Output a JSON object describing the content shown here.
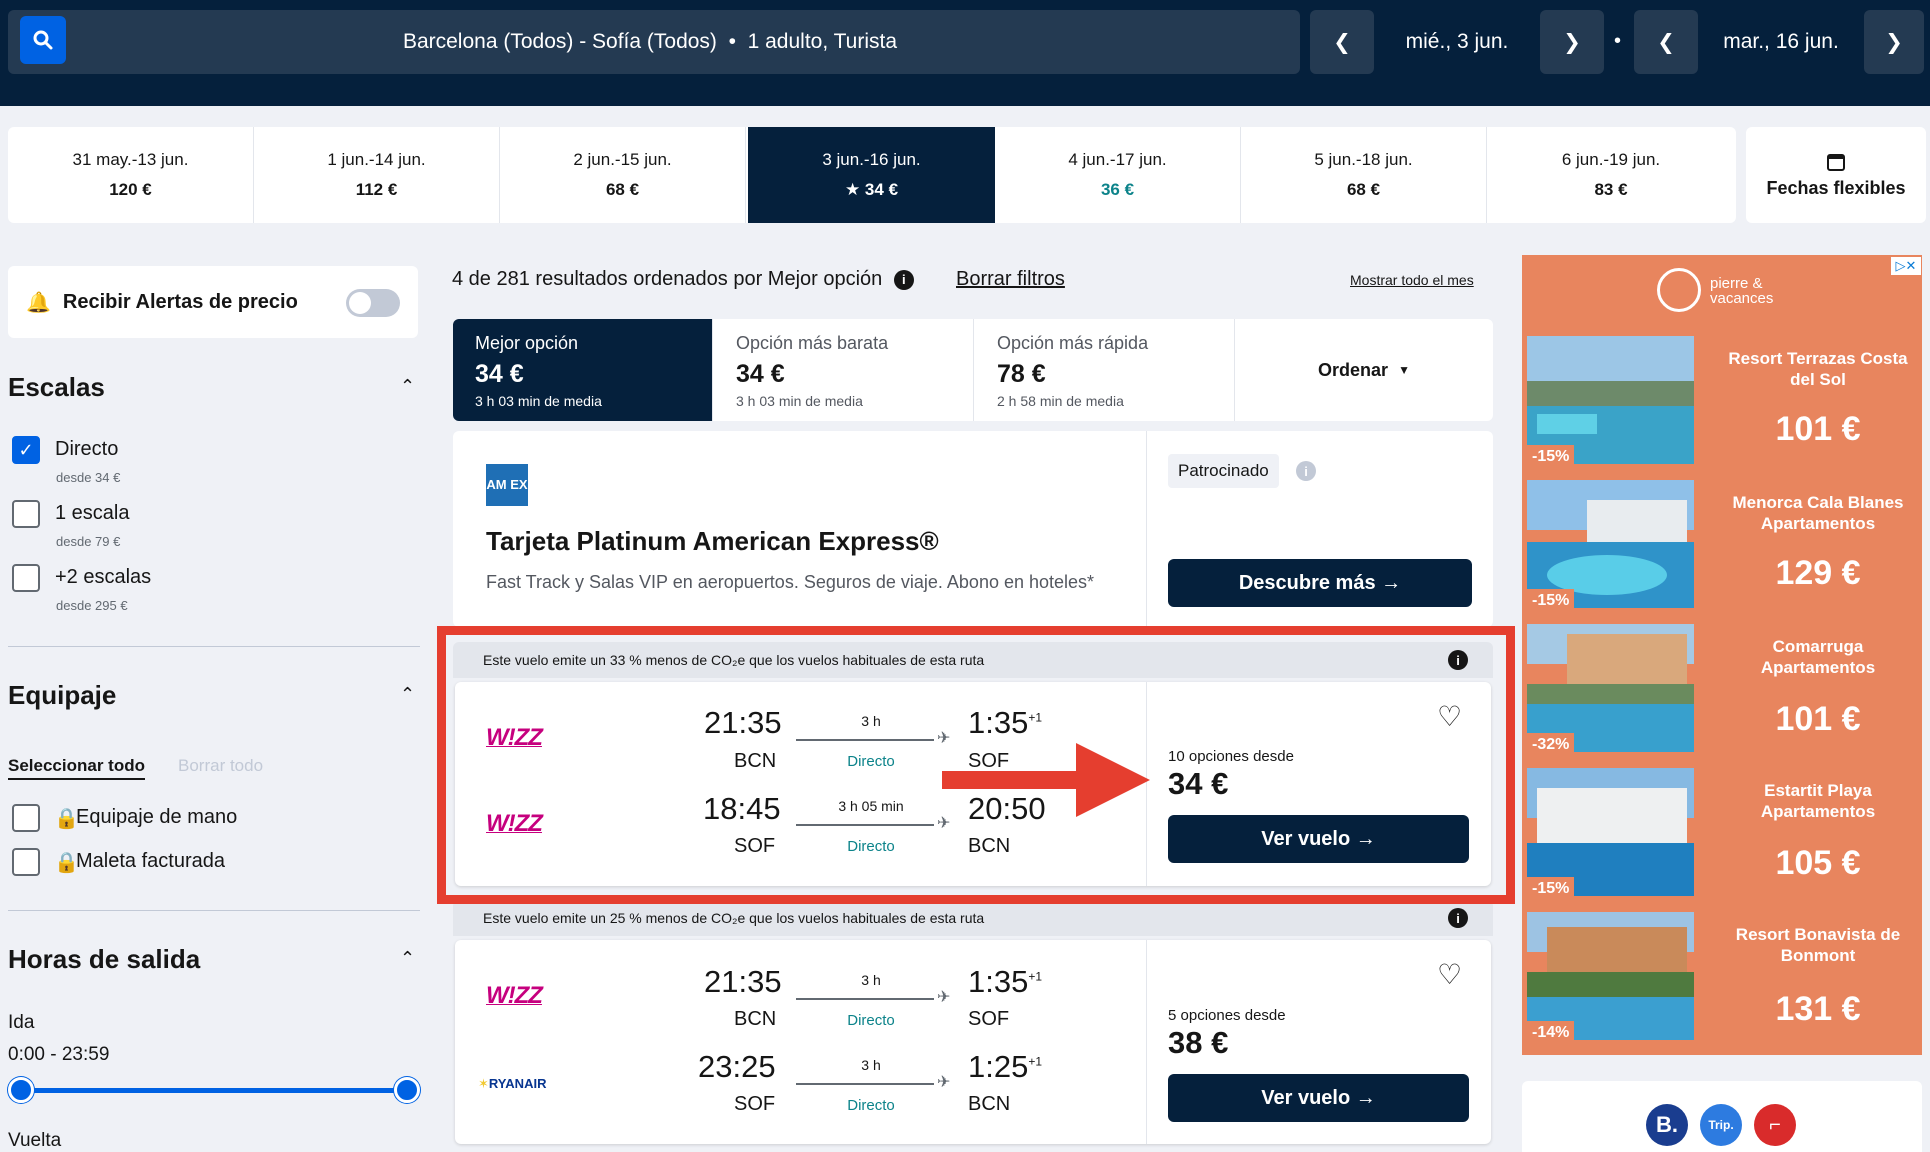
{
  "search": {
    "route": "Barcelona (Todos) - Sofía (Todos)  •  1 adulto, Turista",
    "depart_date": "mié., 3 jun.",
    "return_date": "mar., 16 jun."
  },
  "date_strip": [
    {
      "dates": "31 may.-13 jun.",
      "price": "120 €"
    },
    {
      "dates": "1 jun.-14 jun.",
      "price": "112 €"
    },
    {
      "dates": "2 jun.-15 jun.",
      "price": "68 €"
    },
    {
      "dates": "3 jun.-16 jun.",
      "price": "★ 34 €"
    },
    {
      "dates": "4 jun.-17 jun.",
      "price": "36 €"
    },
    {
      "dates": "5 jun.-18 jun.",
      "price": "68 €"
    },
    {
      "dates": "6 jun.-19 jun.",
      "price": "83 €"
    }
  ],
  "flexible_dates": "Fechas flexibles",
  "sidebar": {
    "alerts_label": "Recibir Alertas de precio",
    "stops_title": "Escalas",
    "stops": [
      {
        "label": "Directo",
        "sub": "desde 34 €",
        "checked": true
      },
      {
        "label": "1 escala",
        "sub": "desde 79 €",
        "checked": false
      },
      {
        "label": "+2 escalas",
        "sub": "desde 295 €",
        "checked": false
      }
    ],
    "baggage_title": "Equipaje",
    "select_all": "Seleccionar todo",
    "clear_all": "Borrar todo",
    "baggage": [
      "Equipaje de mano",
      "Maleta facturada"
    ],
    "times_title": "Horas de salida",
    "outbound_label": "Ida",
    "outbound_range": "0:00 - 23:59",
    "return_label": "Vuelta"
  },
  "results": {
    "summary": "4 de 281 resultados ordenados por Mejor opción",
    "clear_filters": "Borrar filtros",
    "whole_month": "Mostrar todo el mes"
  },
  "sort_tabs": [
    {
      "title": "Mejor opción",
      "price": "34 €",
      "sub": "3 h 03 min de media"
    },
    {
      "title": "Opción más barata",
      "price": "34 €",
      "sub": "3 h 03 min de media"
    },
    {
      "title": "Opción más rápida",
      "price": "78 €",
      "sub": "2 h 58 min de media"
    }
  ],
  "order_label": "Ordenar",
  "sponsored_ad": {
    "logo_text": "AM EX",
    "title": "Tarjeta Platinum American Express®",
    "description": "Fast Track y Salas VIP en aeropuertos. Seguros de viaje. Abono en hoteles*",
    "badge": "Patrocinado",
    "cta": "Descubre más →"
  },
  "flights": [
    {
      "eco_note": "Este vuelo emite un 33 % menos de CO₂e que los vuelos habituales de esta ruta",
      "legs": [
        {
          "airline": "W!ZZ",
          "dep_time": "21:35",
          "dep_code": "BCN",
          "duration": "3 h",
          "stops": "Directo",
          "arr_time": "1:35",
          "arr_plus": "+1",
          "arr_code": "SOF"
        },
        {
          "airline": "W!ZZ",
          "dep_time": "18:45",
          "dep_code": "SOF",
          "duration": "3 h 05 min",
          "stops": "Directo",
          "arr_time": "20:50",
          "arr_plus": "",
          "arr_code": "BCN"
        }
      ],
      "options": "10 opciones desde",
      "price": "34 €",
      "cta": "Ver vuelo →"
    },
    {
      "eco_note": "Este vuelo emite un 25 % menos de CO₂e que los vuelos habituales de esta ruta",
      "legs": [
        {
          "airline": "W!ZZ",
          "dep_time": "21:35",
          "dep_code": "BCN",
          "duration": "3 h",
          "stops": "Directo",
          "arr_time": "1:35",
          "arr_plus": "+1",
          "arr_code": "SOF"
        },
        {
          "airline": "RYANAIR",
          "dep_time": "23:25",
          "dep_code": "SOF",
          "duration": "3 h",
          "stops": "Directo",
          "arr_time": "1:25",
          "arr_plus": "+1",
          "arr_code": "BCN"
        }
      ],
      "options": "5 opciones desde",
      "price": "38 €",
      "cta": "Ver vuelo →"
    }
  ],
  "hotel_ad": {
    "brand": "pierre & vacances",
    "items": [
      {
        "name": "Resort Terrazas Costa del Sol",
        "price": "101 €",
        "discount": "-15%"
      },
      {
        "name": "Menorca Cala Blanes Apartamentos",
        "price": "129 €",
        "discount": "-15%"
      },
      {
        "name": "Comarruga Apartamentos",
        "price": "101 €",
        "discount": "-32%"
      },
      {
        "name": "Estartit Playa Apartamentos",
        "price": "105 €",
        "discount": "-15%"
      },
      {
        "name": "Resort Bonavista de Bonmont",
        "price": "131 €",
        "discount": "-14%"
      }
    ]
  },
  "partners": [
    "B.",
    "Trip.",
    "⌐"
  ],
  "colors": {
    "navy": "#05203c",
    "accent": "#0062e3",
    "highlight": "#e53e2f",
    "ad_bg": "#e8855e"
  }
}
